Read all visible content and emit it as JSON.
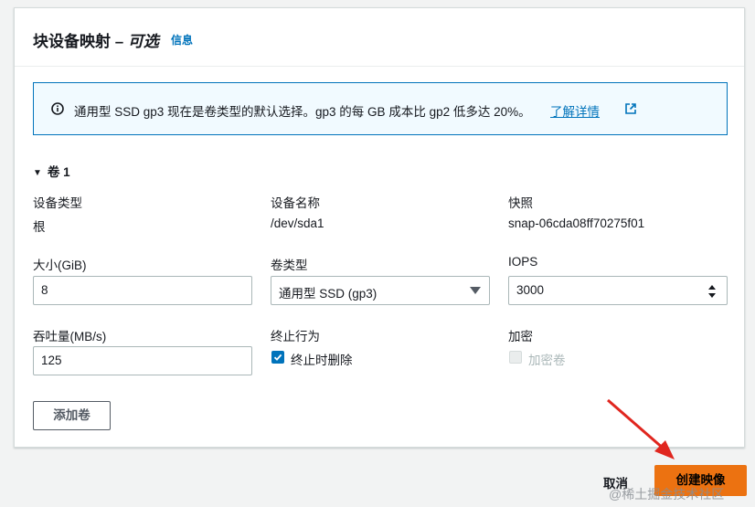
{
  "panel": {
    "title_main": "块设备映射 – ",
    "title_optional": "可选",
    "info_link": "信息"
  },
  "alert": {
    "text": "通用型 SSD gp3 现在是卷类型的默认选择。gp3 的每 GB 成本比 gp2 低多达 20%。",
    "learn_more": "了解详情",
    "icon": "info-circle-icon"
  },
  "volume": {
    "toggle_label": "卷 1",
    "device_type": {
      "label": "设备类型",
      "value": "根"
    },
    "device_name": {
      "label": "设备名称",
      "value": "/dev/sda1"
    },
    "snapshot": {
      "label": "快照",
      "value": "snap-06cda08ff70275f01"
    },
    "size": {
      "label": "大小(GiB)",
      "value": "8"
    },
    "volume_type": {
      "label": "卷类型",
      "value": "通用型 SSD (gp3)"
    },
    "iops": {
      "label": "IOPS",
      "value": "3000"
    },
    "throughput": {
      "label": "吞吐量(MB/s)",
      "value": "125"
    },
    "termination": {
      "label": "终止行为",
      "checkbox_label": "终止时删除",
      "checked": true
    },
    "encryption": {
      "label": "加密",
      "checkbox_label": "加密卷",
      "checked": false,
      "disabled": true
    }
  },
  "buttons": {
    "add_volume": "添加卷",
    "cancel": "取消",
    "create_image": "创建映像"
  },
  "watermark": "@稀土掘金技术社区",
  "colors": {
    "primary_button": "#ec7211",
    "link": "#0073bb",
    "alert_bg": "#f1faff",
    "annotation_arrow": "#e0261f"
  }
}
